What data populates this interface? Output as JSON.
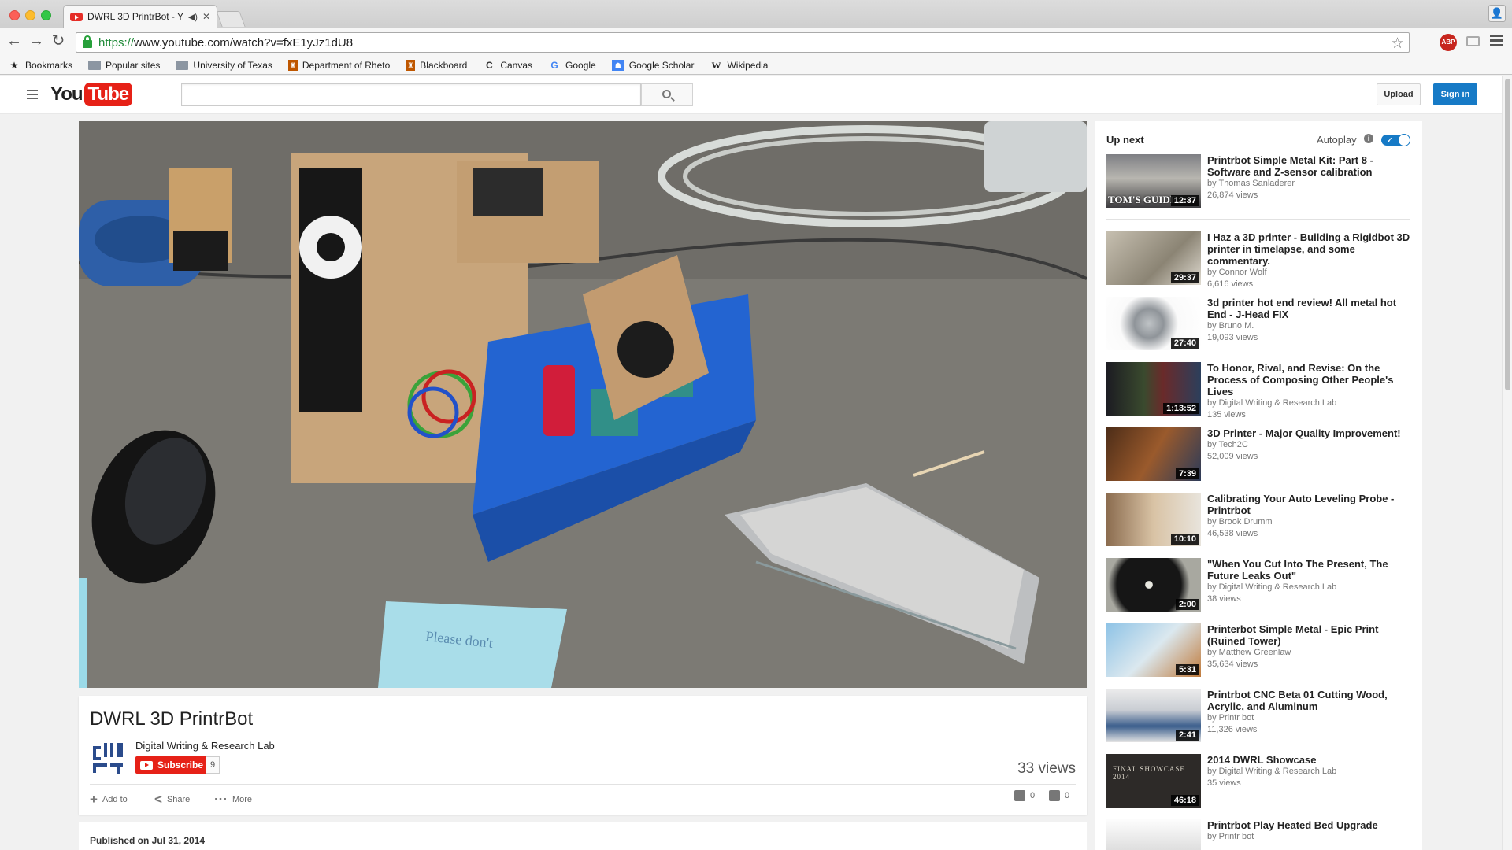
{
  "browser": {
    "tab_title": "DWRL 3D PrintrBot - Yo",
    "url_scheme": "https://",
    "url_rest": "www.youtube.com/watch?v=fxE1yJz1dU8",
    "abp_badge": "ABP",
    "bookmarks": [
      {
        "label": "Bookmarks",
        "icon": "star-icon"
      },
      {
        "label": "Popular sites",
        "icon": "folder-icon"
      },
      {
        "label": "University of Texas",
        "icon": "folder-icon"
      },
      {
        "label": "Department of Rheto",
        "icon": "ut-icon"
      },
      {
        "label": "Blackboard",
        "icon": "ut-icon"
      },
      {
        "label": "Canvas",
        "icon": "canvas-icon"
      },
      {
        "label": "Google",
        "icon": "google-icon"
      },
      {
        "label": "Google Scholar",
        "icon": "google-scholar-icon"
      },
      {
        "label": "Wikipedia",
        "icon": "wikipedia-icon"
      }
    ]
  },
  "header": {
    "logo_you": "You",
    "logo_tube": "Tube",
    "search_placeholder": "",
    "upload_label": "Upload",
    "signin_label": "Sign in"
  },
  "video": {
    "title": "DWRL 3D PrintrBot",
    "channel": "Digital Writing & Research Lab",
    "subscribe_label": "Subscribe",
    "subscriber_count": "9",
    "views": "33 views",
    "add_to_label": "Add to",
    "share_label": "Share",
    "more_label": "More",
    "likes": "0",
    "dislikes": "0",
    "published": "Published on Jul 31, 2014"
  },
  "sidebar": {
    "up_next_label": "Up next",
    "autoplay_label": "Autoplay",
    "autoplay_on": true,
    "items": [
      {
        "title": "Printrbot Simple Metal Kit: Part 8 - Software and Z-sensor calibration",
        "by": "by Thomas Sanladerer",
        "views": "26,874 views",
        "duration": "12:37",
        "brand": "TOM'S GUIDE"
      },
      {
        "title": "I Haz a 3D printer - Building a Rigidbot 3D printer in timelapse, and some commentary.",
        "by": "by Connor Wolf",
        "views": "6,616 views",
        "duration": "29:37"
      },
      {
        "title": "3d printer hot end review! All metal hot End - J-Head FIX",
        "by": "by Bruno M.",
        "views": "19,093 views",
        "duration": "27:40"
      },
      {
        "title": "To Honor, Rival, and Revise: On the Process of Composing Other People's Lives",
        "by": "by Digital Writing & Research Lab",
        "views": "135 views",
        "duration": "1:13:52"
      },
      {
        "title": "3D Printer - Major Quality Improvement!",
        "by": "by Tech2C",
        "views": "52,009 views",
        "duration": "7:39"
      },
      {
        "title": "Calibrating Your Auto Leveling Probe - Printrbot",
        "by": "by Brook Drumm",
        "views": "46,538 views",
        "duration": "10:10"
      },
      {
        "title": "\"When You Cut Into The Present, The Future Leaks Out\"",
        "by": "by Digital Writing & Research Lab",
        "views": "38 views",
        "duration": "2:00"
      },
      {
        "title": "Printerbot Simple Metal - Epic Print (Ruined Tower)",
        "by": "by Matthew Greenlaw",
        "views": "35,634 views",
        "duration": "5:31"
      },
      {
        "title": "Printrbot CNC Beta 01 Cutting Wood, Acrylic, and Aluminum",
        "by": "by Printr bot",
        "views": "11,326 views",
        "duration": "2:41"
      },
      {
        "title": "2014 DWRL Showcase",
        "by": "by Digital Writing & Research Lab",
        "views": "35 views",
        "duration": "46:18",
        "thumb_text": "FINAL SHOWCASE 2014"
      },
      {
        "title": "Printrbot Play Heated Bed Upgrade",
        "by": "by Printr bot",
        "views": "",
        "duration": ""
      }
    ]
  },
  "colors": {
    "brand_red": "#e62117",
    "accent_blue": "#167ac6"
  }
}
